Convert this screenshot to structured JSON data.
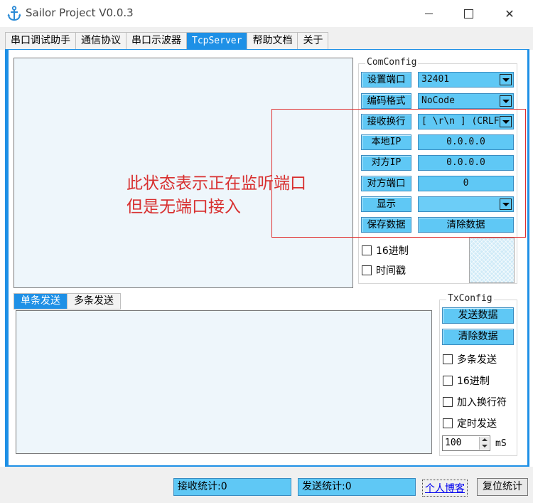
{
  "window": {
    "title": "Sailor Project V0.0.3",
    "close_glyph": "✕"
  },
  "tabs": [
    {
      "label": "串口调试助手"
    },
    {
      "label": "通信协议"
    },
    {
      "label": "串口示波器"
    },
    {
      "label": "TcpServer",
      "active": true
    },
    {
      "label": "帮助文档"
    },
    {
      "label": "关于"
    }
  ],
  "com_config": {
    "group_label": "ComConfig",
    "set_port_label": "设置端口",
    "port_value": "32401",
    "encoding_label": "编码格式",
    "encoding_value": "NoCode",
    "newline_label": "接收换行",
    "newline_value": "[ \\r\\n ] (CRLF)",
    "local_ip_label": "本地IP",
    "local_ip_value": "0.0.0.0",
    "remote_ip_label": "对方IP",
    "remote_ip_value": "0.0.0.0",
    "remote_port_label": "对方端口",
    "remote_port_value": "0",
    "display_label": "显示",
    "display_value": "",
    "save_button": "保存数据",
    "clear_button": "清除数据",
    "hex_checkbox": "16进制",
    "timestamp_checkbox": "时间戳"
  },
  "annotation": {
    "line1": "此状态表示正在监听端口",
    "line2": "但是无端口接入",
    "color": "#d83030"
  },
  "send_tabs": [
    {
      "label": "单条发送",
      "active": true
    },
    {
      "label": "多条发送"
    }
  ],
  "tx_config": {
    "group_label": "TxConfig",
    "send_button": "发送数据",
    "clear_button": "清除数据",
    "multi_send": "多条发送",
    "hex": "16进制",
    "add_newline": "加入换行符",
    "timed_send": "定时发送",
    "interval_value": "100",
    "interval_unit": "mS"
  },
  "status": {
    "recv_count": "接收统计:0",
    "send_count": "发送统计:0",
    "blog_link": "个人博客",
    "reset_button": "复位统计"
  },
  "colors": {
    "accent": "#1e90e6",
    "button": "#5fc8f5",
    "text_area": "#eef6fb"
  }
}
